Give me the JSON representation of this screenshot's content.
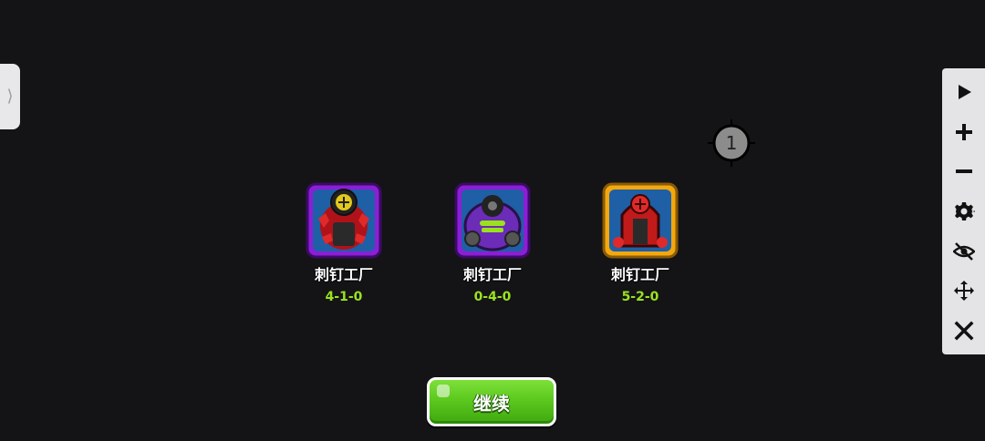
{
  "drawer": {
    "glyph": "⟩"
  },
  "marker": {
    "label": "1"
  },
  "towers": [
    {
      "name": "刺钉工厂",
      "path": "4-1-0",
      "frame": "purple"
    },
    {
      "name": "刺钉工厂",
      "path": "0-4-0",
      "frame": "purple"
    },
    {
      "name": "刺钉工厂",
      "path": "5-2-0",
      "frame": "gold"
    }
  ],
  "continue_button": {
    "label": "继续"
  },
  "toolbar": {
    "items": [
      "play-icon",
      "plus-icon",
      "minus-icon",
      "gear-icon",
      "eye-off-icon",
      "move-icon",
      "close-icon"
    ]
  },
  "colors": {
    "background": "#141417",
    "path_text": "#9be21d",
    "frame_purple": "#8a1fd6",
    "frame_gold": "#f3a80f",
    "button_green": "#5cc91e"
  }
}
